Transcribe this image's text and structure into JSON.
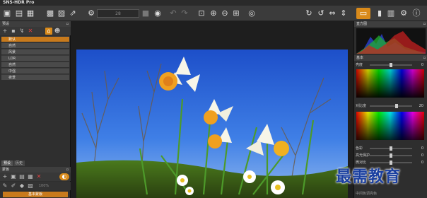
{
  "app": {
    "title": "SNS-HDR Pro"
  },
  "toolbar": {
    "zoom_value": "28"
  },
  "presets": {
    "header": "预设",
    "items": [
      {
        "label": "默认",
        "selected": true
      },
      {
        "label": "自然",
        "selected": false
      },
      {
        "label": "风景",
        "selected": false
      },
      {
        "label": "LDR",
        "selected": false
      },
      {
        "label": "自然",
        "selected": false
      },
      {
        "label": "中强",
        "selected": false
      },
      {
        "label": "夜景",
        "selected": false
      }
    ]
  },
  "left_tabs": [
    "预设",
    "历史"
  ],
  "left_lower": {
    "header": "蒙板",
    "zoom_value": "100%",
    "apply_button": "基本蒙版"
  },
  "right": {
    "histogram_header": "直方图",
    "basic_header": "基本",
    "brightness": {
      "label": "亮度",
      "value": "0"
    },
    "contrast": {
      "label": "对比度",
      "value": "20"
    },
    "saturation": {
      "label": "色彩",
      "value": "0"
    },
    "highlight": {
      "label": "高光保护",
      "value": "0"
    },
    "microcontrast": {
      "label": "微对比",
      "value": "0"
    },
    "bottom_label": "中间色调亮色"
  },
  "watermark": "最需教育",
  "colors": {
    "accent": "#c87a1c",
    "toolbar": "#3b3b3b",
    "panel": "#2f2f2f"
  }
}
